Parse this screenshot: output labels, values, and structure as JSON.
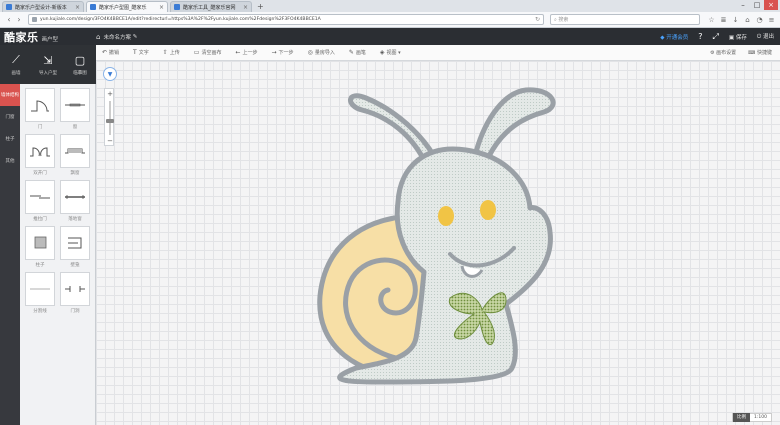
{
  "browser": {
    "tabs": [
      {
        "title": "酷家乐户型设计-新版本",
        "active": false
      },
      {
        "title": "酷家乐户型图_酷家乐",
        "active": true
      },
      {
        "title": "酷家乐工具_酷家乐官网",
        "active": false
      }
    ],
    "new_tab": "+",
    "url": "yun.kujiale.com/design/3FO4K4BBCE1A/edit?redirecturl=https%3A%2F%2Fyun.kujiale.com%2Fdesign%2F3FO4K4BBCE1A",
    "search_placeholder": "搜索"
  },
  "app": {
    "logo": "酷家乐",
    "logo_sub": "画户型",
    "doc_title": "未命名方案",
    "top_actions": {
      "vip": "开通会员",
      "help": "帮助",
      "fullscreen": "全屏",
      "save": "保存",
      "exit": "退出"
    }
  },
  "left_big_tools": [
    {
      "icon": "draw-wall-icon",
      "label": "画墙"
    },
    {
      "icon": "import-icon",
      "label": "导入户型"
    },
    {
      "icon": "copy-icon",
      "label": "临摹图"
    }
  ],
  "left_categories": [
    {
      "label": "墙体结构",
      "active": true
    },
    {
      "label": "门窗",
      "active": false
    },
    {
      "label": "柱子",
      "active": false
    },
    {
      "label": "其他",
      "active": false
    }
  ],
  "components": [
    {
      "label": "门",
      "icon": "single-door-icon"
    },
    {
      "label": "窗",
      "icon": "window-icon"
    },
    {
      "label": "双开门",
      "icon": "double-door-icon"
    },
    {
      "label": "飘窗",
      "icon": "bay-window-icon"
    },
    {
      "label": "推拉门",
      "icon": "sliding-door-icon"
    },
    {
      "label": "落地窗",
      "icon": "french-window-icon"
    },
    {
      "label": "柱子",
      "icon": "pillar-icon"
    },
    {
      "label": "壁龛",
      "icon": "niche-icon"
    },
    {
      "label": "分割线",
      "icon": "divider-line-icon"
    },
    {
      "label": "门洞",
      "icon": "door-opening-icon"
    }
  ],
  "toolbar2": {
    "items": [
      {
        "icon": "undo-icon",
        "label": "撤销"
      },
      {
        "icon": "text-icon",
        "label": "文字"
      },
      {
        "icon": "upload-icon",
        "label": "上传"
      },
      {
        "icon": "clear-icon",
        "label": "清空画布"
      },
      {
        "icon": "prev-icon",
        "label": "上一步"
      },
      {
        "icon": "next-icon",
        "label": "下一步"
      },
      {
        "icon": "measure-icon",
        "label": "量房导入"
      },
      {
        "icon": "pen-icon",
        "label": "画笔"
      },
      {
        "icon": "view-icon",
        "label": "视图"
      }
    ],
    "right": [
      {
        "icon": "settings-icon",
        "label": "画布设置"
      },
      {
        "icon": "shortcut-icon",
        "label": "快捷键"
      }
    ]
  },
  "status": {
    "left": "比例",
    "right": "1:100"
  },
  "colors": {
    "shell_green": "#f7dfa6",
    "body_fill": "#e3e8e6",
    "outline": "#9aa0a6",
    "eye": "#f1c445",
    "bow": "#8aa65a"
  }
}
